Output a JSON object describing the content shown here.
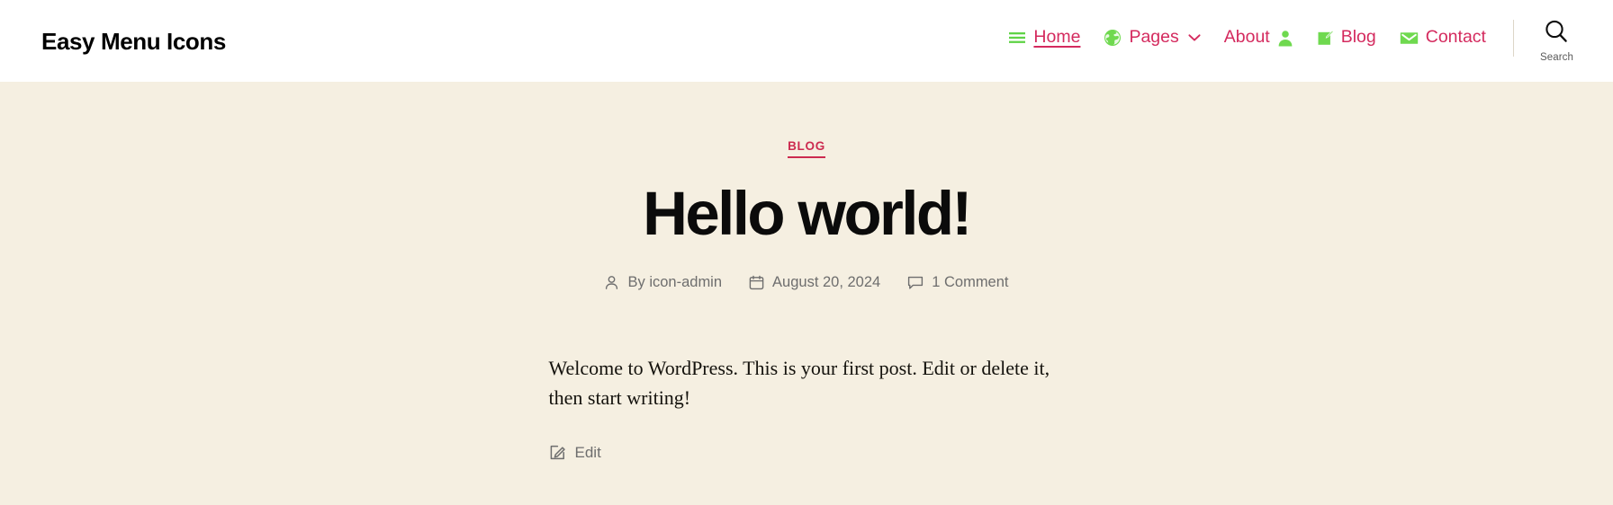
{
  "site": {
    "title": "Easy Menu Icons"
  },
  "header": {
    "nav": [
      {
        "label": "Home",
        "icon": "hamburger-menu-icon",
        "icon_position": "before",
        "current": true,
        "has_caret": false
      },
      {
        "label": "Pages",
        "icon": "globe-icon",
        "icon_position": "before",
        "current": false,
        "has_caret": true
      },
      {
        "label": "About",
        "icon": "person-icon",
        "icon_position": "after",
        "current": false,
        "has_caret": false
      },
      {
        "label": "Blog",
        "icon": "pencil-square-icon",
        "icon_position": "before",
        "current": false,
        "has_caret": false
      },
      {
        "label": "Contact",
        "icon": "envelope-icon",
        "icon_position": "before",
        "current": false,
        "has_caret": false
      }
    ],
    "search": {
      "label": "Search",
      "icon": "magnifier-icon"
    }
  },
  "post": {
    "category": "BLOG",
    "title": "Hello world!",
    "meta": {
      "author_icon": "person-outline-icon",
      "author": "By icon-admin",
      "date_icon": "calendar-icon",
      "date": "August 20, 2024",
      "comments_icon": "comment-bubble-icon",
      "comments": "1 Comment"
    },
    "body": "Welcome to WordPress. This is your first post. Edit or delete it, then start writing!",
    "edit": {
      "label": "Edit",
      "icon": "edit-pencil-icon"
    }
  },
  "colors": {
    "accent_link": "#d42a5e",
    "accent_category": "#cc2b50",
    "icon_green": "#5fd346",
    "page_background": "#f5efe1",
    "header_background": "#ffffff"
  }
}
